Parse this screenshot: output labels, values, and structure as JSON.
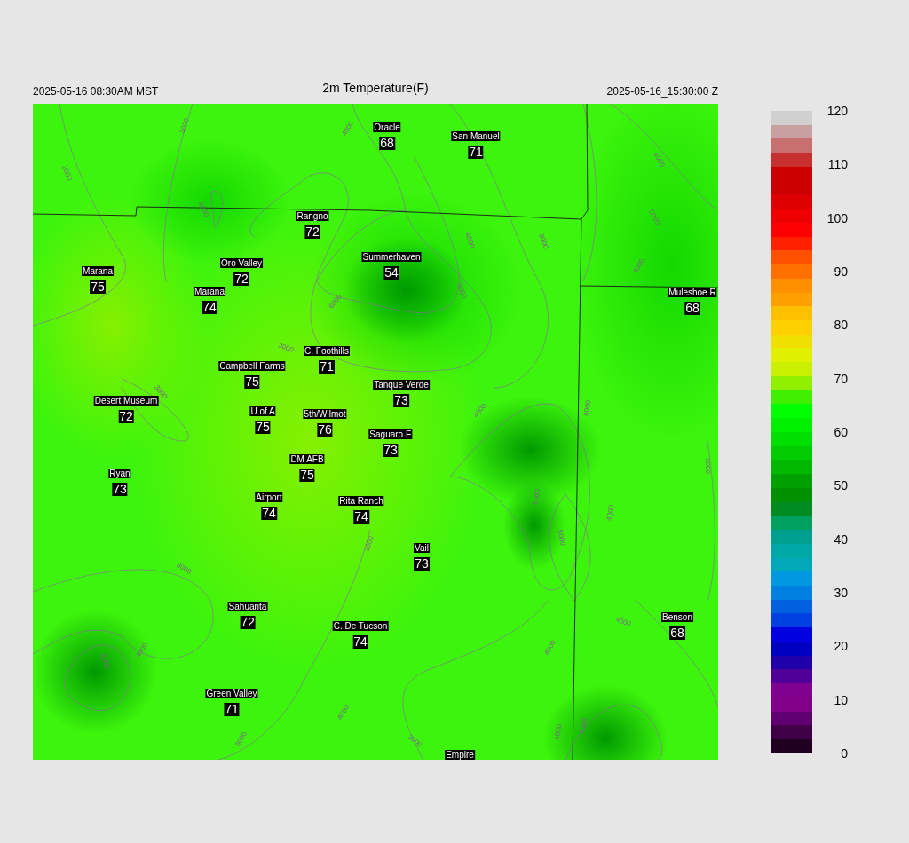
{
  "header": {
    "valid_local": "2025-05-16 08:30AM MST",
    "title": "2m Temperature(F)",
    "valid_utc": "2025-05-16_15:30:00 Z"
  },
  "stations": [
    {
      "name": "Oracle",
      "value": "68"
    },
    {
      "name": "San Manuel",
      "value": "71"
    },
    {
      "name": "Rangno",
      "value": "72"
    },
    {
      "name": "Summerhaven",
      "value": "54"
    },
    {
      "name": "Marana",
      "value": "75"
    },
    {
      "name": "Oro Valley",
      "value": "72"
    },
    {
      "name": "Marana",
      "value": "74"
    },
    {
      "name": "Muleshoe R",
      "value": "68"
    },
    {
      "name": "C. Foothills",
      "value": "71"
    },
    {
      "name": "Campbell Farms",
      "value": "75"
    },
    {
      "name": "Tanque Verde",
      "value": "73"
    },
    {
      "name": "Desert Museum",
      "value": "72"
    },
    {
      "name": "U of A",
      "value": "75"
    },
    {
      "name": "5th/Wilmot",
      "value": "76"
    },
    {
      "name": "Saguaro E",
      "value": "73"
    },
    {
      "name": "DM AFB",
      "value": "75"
    },
    {
      "name": "Ryan",
      "value": "73"
    },
    {
      "name": "Airport",
      "value": "74"
    },
    {
      "name": "Rita Ranch",
      "value": "74"
    },
    {
      "name": "Vail",
      "value": "73"
    },
    {
      "name": "Sahuarita",
      "value": "72"
    },
    {
      "name": "C. De Tucson",
      "value": "74"
    },
    {
      "name": "Benson",
      "value": "68"
    },
    {
      "name": "Green Valley",
      "value": "71"
    },
    {
      "name": "Empire"
    }
  ],
  "contour_labels": [
    "3000",
    "2000",
    "4000",
    "4000",
    "3000",
    "6000",
    "5000",
    "4000",
    "3000",
    "4000",
    "5000",
    "4000",
    "3000",
    "4000",
    "4000",
    "5000",
    "4000",
    "5000",
    "3000",
    "3000",
    "3000",
    "4000",
    "4000",
    "4000",
    "4000",
    "4000",
    "3000",
    "3000",
    "4000",
    "5000"
  ],
  "colorbar": {
    "ticks": [
      "120",
      "110",
      "100",
      "90",
      "80",
      "70",
      "60",
      "50",
      "40",
      "30",
      "20",
      "10",
      "0"
    ]
  }
}
